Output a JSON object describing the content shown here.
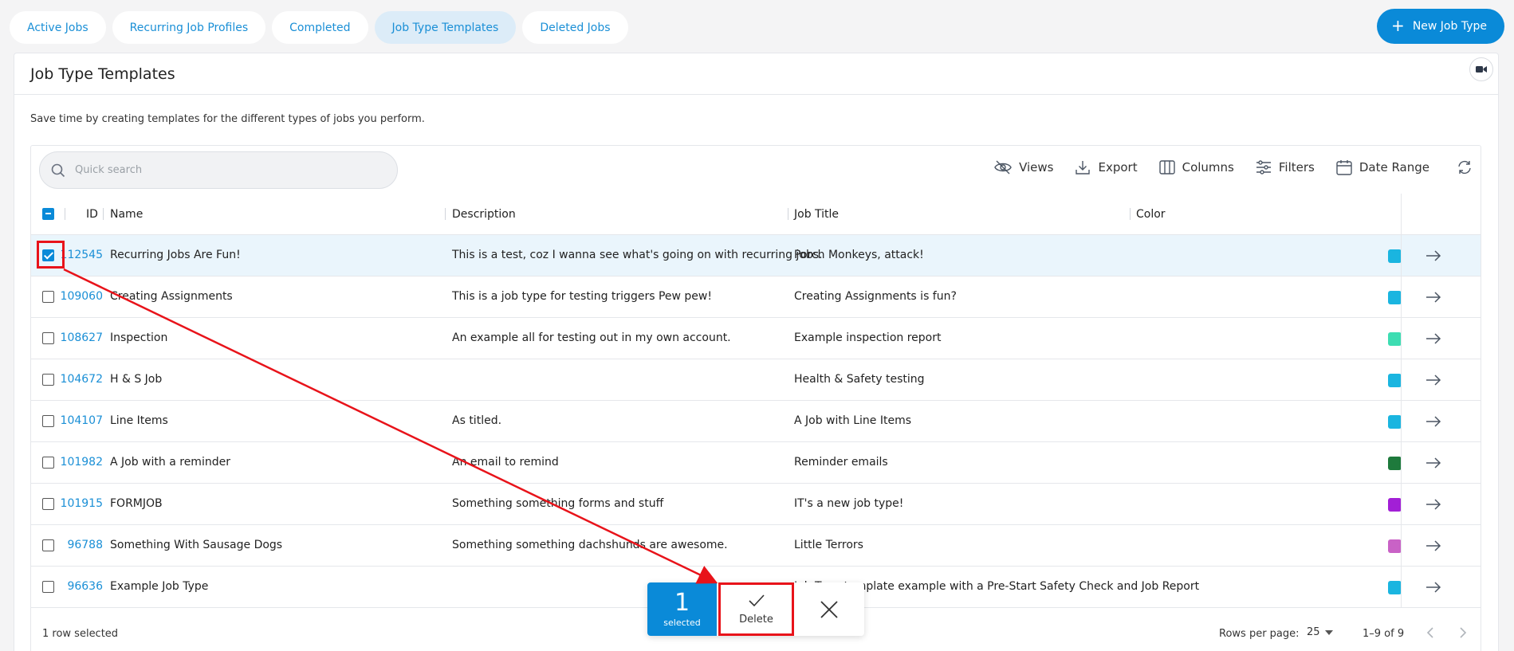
{
  "tabs": [
    {
      "label": "Active Jobs",
      "active": false
    },
    {
      "label": "Recurring Job Profiles",
      "active": false
    },
    {
      "label": "Completed",
      "active": false
    },
    {
      "label": "Job Type Templates",
      "active": true
    },
    {
      "label": "Deleted Jobs",
      "active": false
    }
  ],
  "new_button": {
    "label": "New Job Type",
    "icon": "plus-icon"
  },
  "card": {
    "title": "Job Type Templates",
    "subtitle": "Save time by creating templates for the different types of jobs you perform.",
    "video_icon": "video-camera-icon"
  },
  "search": {
    "placeholder": "Quick search",
    "value": ""
  },
  "toolbar": {
    "views": "Views",
    "export": "Export",
    "columns": "Columns",
    "filters": "Filters",
    "date_range": "Date Range"
  },
  "columns": {
    "id": "ID",
    "name": "Name",
    "description": "Description",
    "job_title": "Job Title",
    "color": "Color"
  },
  "rows": [
    {
      "id": "112545",
      "name": "Recurring Jobs Are Fun!",
      "description": "This is a test, coz I wanna see what's going on with recurring jobs.",
      "job_title": "Porch Monkeys, attack!",
      "color": "#1ab5e0",
      "selected": true
    },
    {
      "id": "109060",
      "name": "Creating Assignments",
      "description": "This is a job type for testing triggers Pew pew!",
      "job_title": "Creating Assignments is fun?",
      "color": "#1ab5e0",
      "selected": false
    },
    {
      "id": "108627",
      "name": "Inspection",
      "description": "An example all for testing out in my own account.",
      "job_title": "Example inspection report",
      "color": "#3dddb2",
      "selected": false
    },
    {
      "id": "104672",
      "name": "H & S Job",
      "description": "",
      "job_title": "Health & Safety testing",
      "color": "#1ab5e0",
      "selected": false
    },
    {
      "id": "104107",
      "name": "Line Items",
      "description": "As titled.",
      "job_title": "A Job with Line Items",
      "color": "#1ab5e0",
      "selected": false
    },
    {
      "id": "101982",
      "name": "A Job with a reminder",
      "description": "An email to remind",
      "job_title": "Reminder emails",
      "color": "#1e7a3c",
      "selected": false
    },
    {
      "id": "101915",
      "name": "FORMJOB",
      "description": "Something something forms and stuff",
      "job_title": "IT's a new job type!",
      "color": "#a21fd6",
      "selected": false
    },
    {
      "id": "96788",
      "name": "Something With Sausage Dogs",
      "description": "Something something dachshunds are awesome.",
      "job_title": "Little Terrors",
      "color": "#c962c6",
      "selected": false
    },
    {
      "id": "96636",
      "name": "Example Job Type",
      "description": "",
      "job_title": "Job Type template example with a Pre-Start Safety Check and Job Report",
      "color": "#1ab5e0",
      "selected": false
    }
  ],
  "footer": {
    "selected_text": "1 row selected",
    "rows_per_page_label": "Rows per page:",
    "rows_per_page_value": "25",
    "range": "1–9 of 9"
  },
  "actionbar": {
    "count": "1",
    "count_label": "selected",
    "delete_label": "Delete"
  },
  "colors": {
    "accent": "#0a8ad8",
    "annotation": "#e8131a",
    "selected_row": "#eaf5fc"
  }
}
